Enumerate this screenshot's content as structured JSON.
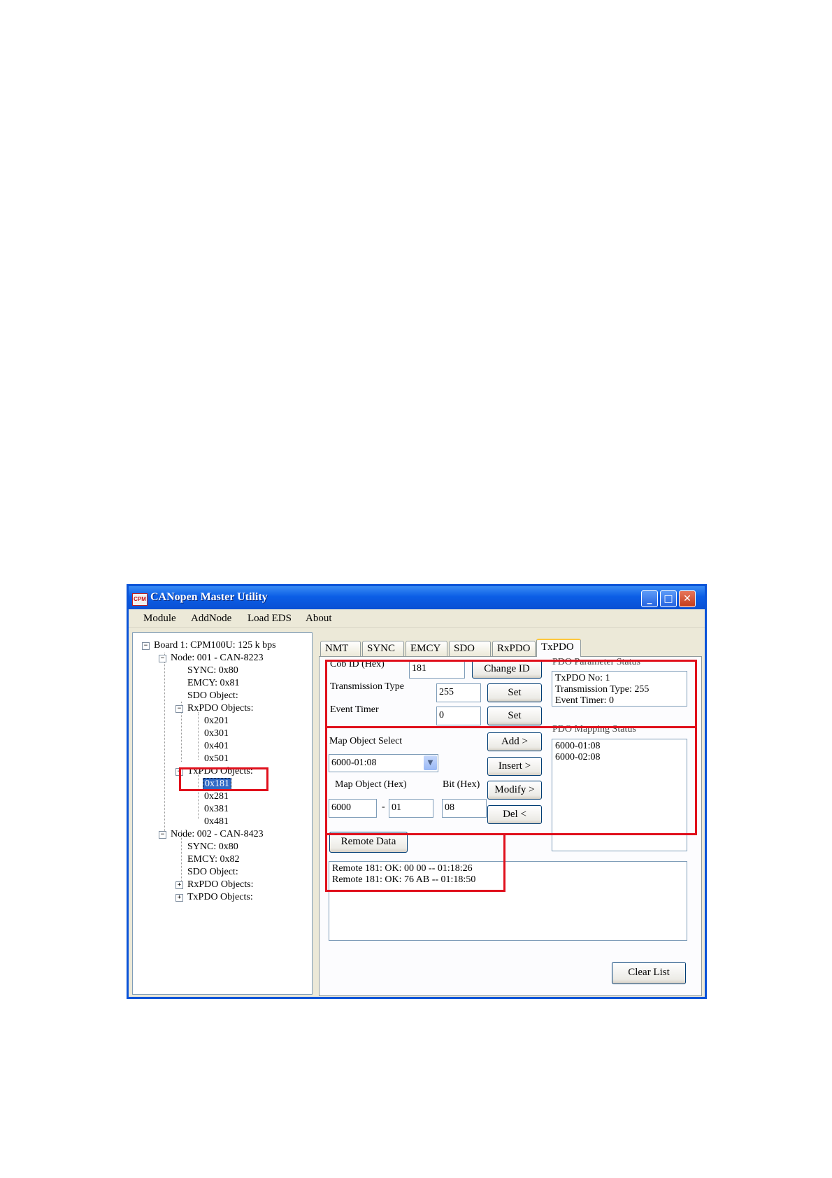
{
  "window": {
    "app_icon": "CPM",
    "title": "CANopen Master Utility",
    "controls": {
      "minimize": "minimize-icon",
      "maximize": "maximize-icon",
      "close": "close-icon"
    }
  },
  "menu": [
    "Module",
    "AddNode",
    "Load EDS",
    "About"
  ],
  "tree": {
    "board": "Board 1: CPM100U:  125 k bps",
    "node1": {
      "label": "Node: 001 - CAN-8223",
      "sync": "SYNC: 0x80",
      "emcy": "EMCY: 0x81",
      "sdo": "SDO Object:",
      "rxpdo_label": "RxPDO Objects:",
      "rxpdo": [
        "0x201",
        "0x301",
        "0x401",
        "0x501"
      ],
      "txpdo_label": "TxPDO Objects:",
      "txpdo": [
        "0x181",
        "0x281",
        "0x381",
        "0x481"
      ]
    },
    "node2": {
      "label": "Node: 002 - CAN-8423",
      "sync": "SYNC: 0x80",
      "emcy": "EMCY: 0x82",
      "sdo": "SDO Object:",
      "rxpdo_label": "RxPDO Objects:",
      "txpdo_label": "TxPDO Objects:"
    }
  },
  "tabs": [
    "NMT",
    "SYNC",
    "EMCY",
    "SDO",
    "RxPDO",
    "TxPDO"
  ],
  "active_tab": "TxPDO",
  "txpdo": {
    "cob_id_label": "Cob ID (Hex)",
    "cob_id_value": "181",
    "change_id_button": "Change ID",
    "transmission_type_label": "Transmission Type",
    "transmission_type_value": "255",
    "event_timer_label": "Event Timer",
    "event_timer_value": "0",
    "set_button": "Set",
    "param_status_label": "PDO Parameter Status",
    "param_status": [
      "TxPDO No: 1",
      "Transmission Type: 255",
      "Event Timer: 0"
    ],
    "map_object_select_label": "Map Object  Select",
    "map_object_select_value": "6000-01:08",
    "map_object_hex_label": "Map Object (Hex)",
    "bit_hex_label": "Bit (Hex)",
    "map_index": "6000",
    "dash": "-",
    "map_subindex": "01",
    "bit_value": "08",
    "add_button": "Add    >",
    "insert_button": "Insert  >",
    "modify_button": "Modify >",
    "del_button": "Del    <",
    "mapping_status_label": "PDO Mapping Status",
    "mapping_status": [
      "6000-01:08",
      "6000-02:08"
    ],
    "remote_data_button": "Remote Data",
    "remote_log": [
      "Remote 181: OK: 00 00  -- 01:18:26",
      "Remote 181: OK: 76 AB  -- 01:18:50"
    ],
    "clear_list_button": "Clear List"
  },
  "highlight_color": "#e0101c",
  "title_bar_color": "#0a5ee6"
}
